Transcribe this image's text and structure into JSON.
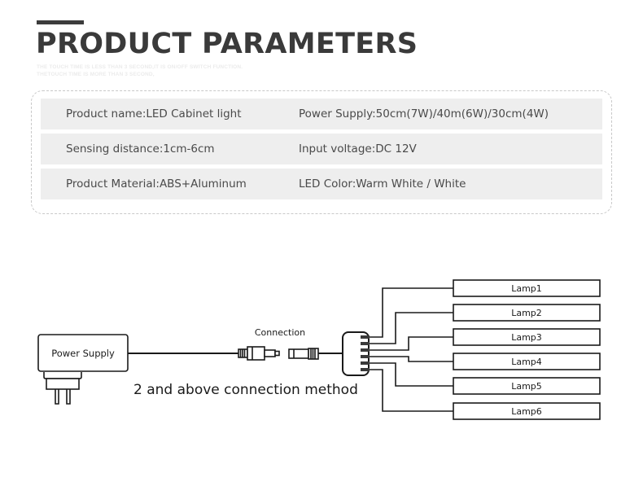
{
  "header": {
    "accent_color": "#3c3c3c",
    "title": "PRODUCT PARAMETERS",
    "subtitle_line1": "THE TOUCH TIME IS LESS THAN 3 SECOND,IT IS ON/OFF SWITCH FUNCTION.",
    "subtitle_line2": "THETOUCH TIME IS MORE THAN 3 SECOND,"
  },
  "spec_table": {
    "row_background": "#eeeeee",
    "border_style": "dashed",
    "border_color": "#c8c8c8",
    "rows": [
      {
        "left": "Product name:LED Cabinet light",
        "right": "Power Supply:50cm(7W)/40m(6W)/30cm(4W)"
      },
      {
        "left": "Sensing distance:1cm-6cm",
        "right": "Input voltage:DC 12V"
      },
      {
        "left": "Product Material:ABS+Aluminum",
        "right": "LED Color:Warm White / White"
      }
    ]
  },
  "diagram": {
    "power_supply_label": "Power Supply",
    "connection_label": "Connection",
    "method_label": "2 and above connection method",
    "line_color": "#1a1a1a",
    "lamps": [
      {
        "label": "Lamp1"
      },
      {
        "label": "Lamp2"
      },
      {
        "label": "Lamp3"
      },
      {
        "label": "Lamp4"
      },
      {
        "label": "Lamp5"
      },
      {
        "label": "Lamp6"
      }
    ]
  }
}
